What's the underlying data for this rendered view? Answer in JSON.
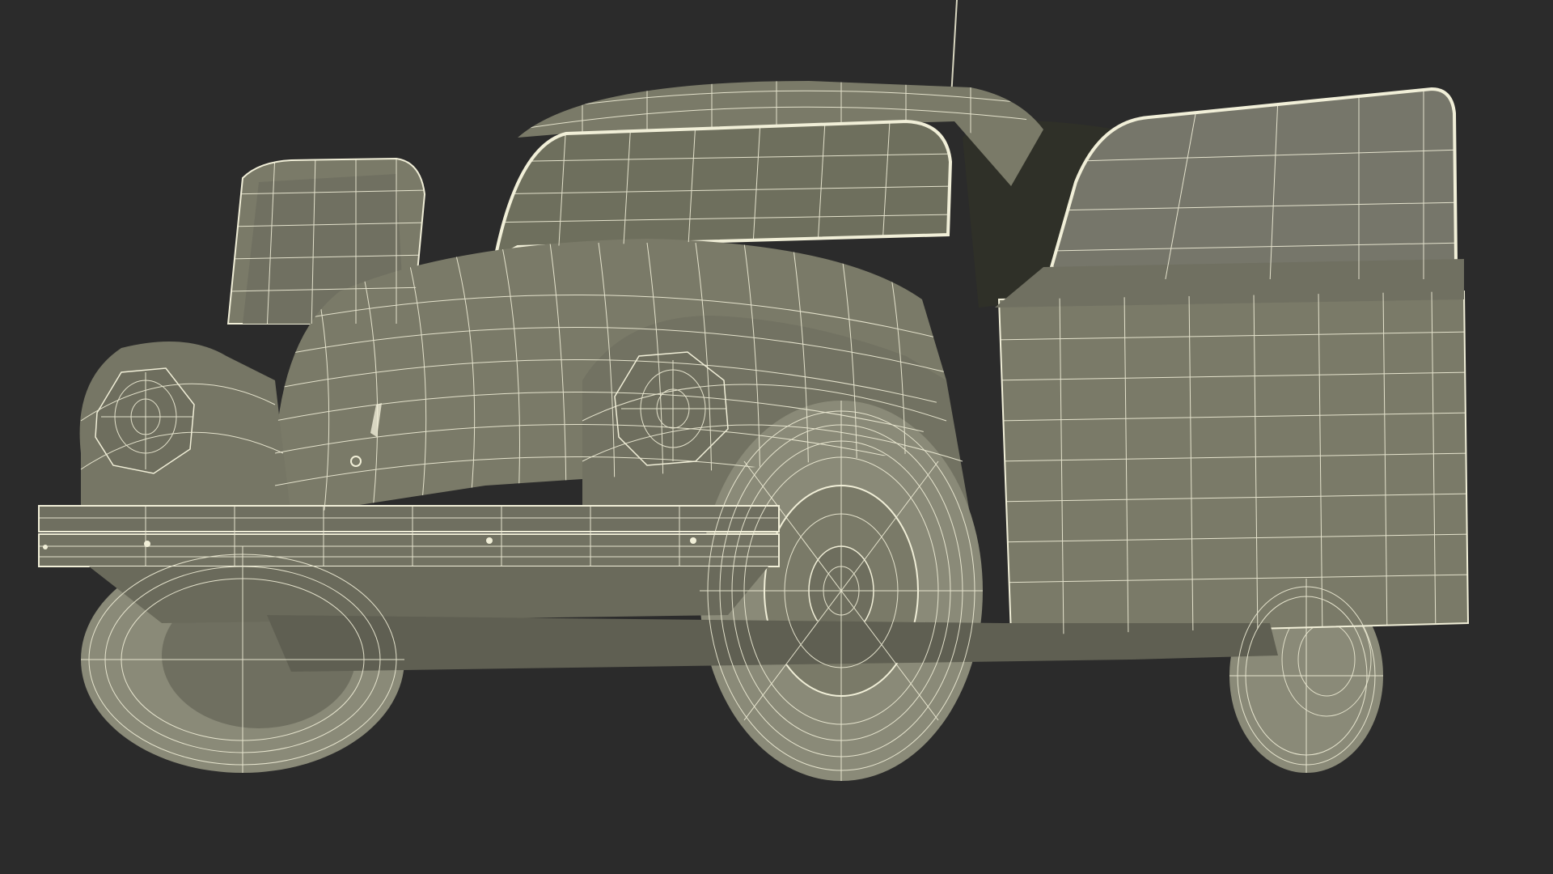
{
  "scene": {
    "background": "#2b2b2b",
    "body_color": "#7a7a68",
    "body_shade": "#6b6b5c",
    "dark_interior": "#2f3028",
    "wire_color": "#f1efd8",
    "tire_color": "#8a8a78",
    "subject_icon": "wireframe-car-model"
  }
}
